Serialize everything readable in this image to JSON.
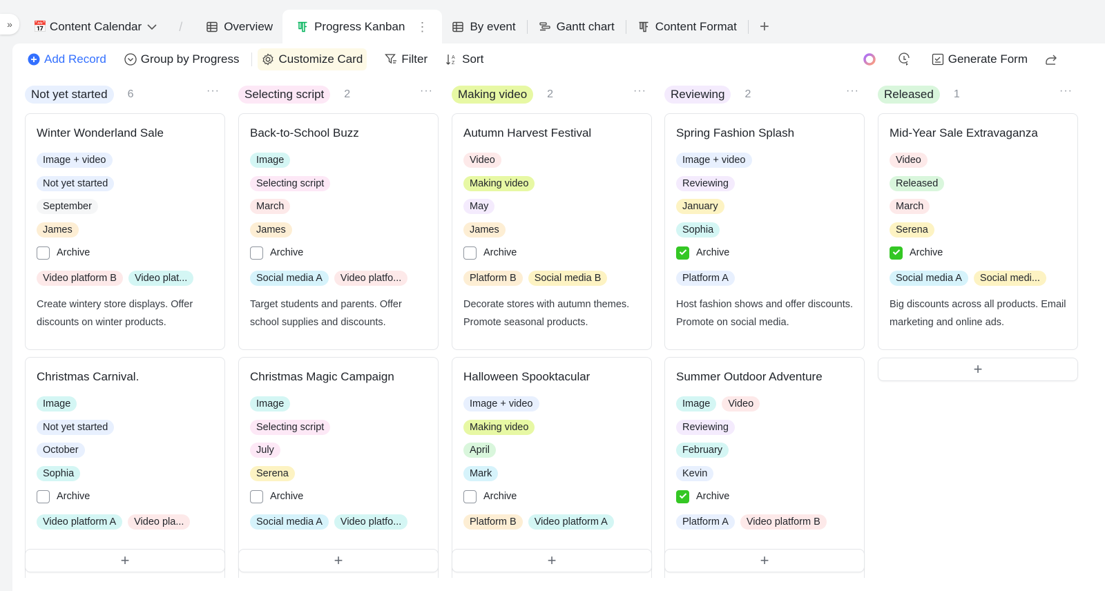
{
  "header": {
    "base_title": "Content Calendar",
    "tabs": [
      {
        "label": "Overview",
        "icon": "grid-table-icon"
      },
      {
        "label": "Progress Kanban",
        "icon": "kanban-icon",
        "active": true
      },
      {
        "label": "By event",
        "icon": "grid-table-icon"
      },
      {
        "label": "Gantt chart",
        "icon": "gantt-icon"
      },
      {
        "label": "Content Format",
        "icon": "kanban-icon"
      }
    ]
  },
  "toolbar": {
    "add_record": "Add Record",
    "group_by": "Group by Progress",
    "customize_card": "Customize Card",
    "filter": "Filter",
    "sort": "Sort",
    "generate_form": "Generate Form"
  },
  "columns": [
    {
      "name": "Not yet started",
      "count": "6",
      "color": "c-blue",
      "cards": [
        {
          "title": "Winter Wonderland Sale",
          "format": [
            {
              "t": "Image + video",
              "c": "c-blue"
            }
          ],
          "progress": {
            "t": "Not yet started",
            "c": "c-blue"
          },
          "month": {
            "t": "September",
            "c": "c-gray"
          },
          "owner": {
            "t": "James",
            "c": "c-orange"
          },
          "archive_label": "Archive",
          "archived": false,
          "channels": [
            {
              "t": "Video platform B",
              "c": "c-red"
            },
            {
              "t": "Video plat...",
              "c": "c-cyan"
            }
          ],
          "description": "Create wintery store displays. Offer discounts on winter products."
        },
        {
          "title": "Christmas Carnival.",
          "format": [
            {
              "t": "Image",
              "c": "c-cyan"
            }
          ],
          "progress": {
            "t": "Not yet started",
            "c": "c-blue"
          },
          "month": {
            "t": "October",
            "c": "c-blue"
          },
          "owner": {
            "t": "Sophia",
            "c": "c-cyan"
          },
          "archive_label": "Archive",
          "archived": false,
          "channels": [
            {
              "t": "Video platform A",
              "c": "c-cyan"
            },
            {
              "t": "Video pla...",
              "c": "c-red"
            }
          ],
          "description": ""
        }
      ]
    },
    {
      "name": "Selecting script",
      "count": "2",
      "color": "c-pink",
      "cards": [
        {
          "title": "Back-to-School Buzz",
          "format": [
            {
              "t": "Image",
              "c": "c-cyan"
            }
          ],
          "progress": {
            "t": "Selecting script",
            "c": "c-pink"
          },
          "month": {
            "t": "March",
            "c": "c-red"
          },
          "owner": {
            "t": "James",
            "c": "c-orange"
          },
          "archive_label": "Archive",
          "archived": false,
          "channels": [
            {
              "t": "Social media A",
              "c": "c-skyblue"
            },
            {
              "t": "Video platfo...",
              "c": "c-red"
            }
          ],
          "description": "Target students and parents. Offer school supplies and discounts."
        },
        {
          "title": "Christmas Magic Campaign",
          "format": [
            {
              "t": "Image",
              "c": "c-cyan"
            }
          ],
          "progress": {
            "t": "Selecting script",
            "c": "c-pink"
          },
          "month": {
            "t": "July",
            "c": "c-pink"
          },
          "owner": {
            "t": "Serena",
            "c": "c-yellow"
          },
          "archive_label": "Archive",
          "archived": false,
          "channels": [
            {
              "t": "Social media A",
              "c": "c-skyblue"
            },
            {
              "t": "Video platfo...",
              "c": "c-cyan"
            }
          ],
          "description": ""
        }
      ]
    },
    {
      "name": "Making video",
      "count": "2",
      "color": "c-lime",
      "cards": [
        {
          "title": "Autumn Harvest Festival",
          "format": [
            {
              "t": "Video",
              "c": "c-red"
            }
          ],
          "progress": {
            "t": "Making video",
            "c": "c-lime"
          },
          "month": {
            "t": "May",
            "c": "c-purple"
          },
          "owner": {
            "t": "James",
            "c": "c-orange"
          },
          "archive_label": "Archive",
          "archived": false,
          "channels": [
            {
              "t": "Platform B",
              "c": "c-orange"
            },
            {
              "t": "Social media B",
              "c": "c-yellow"
            }
          ],
          "description": "Decorate stores with autumn themes. Promote seasonal products."
        },
        {
          "title": "Halloween Spooktacular",
          "format": [
            {
              "t": "Image + video",
              "c": "c-blue"
            }
          ],
          "progress": {
            "t": "Making video",
            "c": "c-lime"
          },
          "month": {
            "t": "April",
            "c": "c-green"
          },
          "owner": {
            "t": "Mark",
            "c": "c-skyblue"
          },
          "archive_label": "Archive",
          "archived": false,
          "channels": [
            {
              "t": "Platform B",
              "c": "c-orange"
            },
            {
              "t": "Video platform A",
              "c": "c-cyan"
            }
          ],
          "description": ""
        }
      ]
    },
    {
      "name": "Reviewing",
      "count": "2",
      "color": "c-purple",
      "cards": [
        {
          "title": "Spring Fashion Splash",
          "format": [
            {
              "t": "Image + video",
              "c": "c-blue"
            }
          ],
          "progress": {
            "t": "Reviewing",
            "c": "c-purple"
          },
          "month": {
            "t": "January",
            "c": "c-yellow"
          },
          "owner": {
            "t": "Sophia",
            "c": "c-cyan"
          },
          "archive_label": "Archive",
          "archived": true,
          "channels": [
            {
              "t": "Platform A",
              "c": "c-blue"
            }
          ],
          "description": "Host fashion shows and offer discounts. Promote on social media."
        },
        {
          "title": "Summer Outdoor Adventure",
          "format": [
            {
              "t": "Image",
              "c": "c-cyan"
            },
            {
              "t": "Video",
              "c": "c-red"
            }
          ],
          "progress": {
            "t": "Reviewing",
            "c": "c-purple"
          },
          "month": {
            "t": "February",
            "c": "c-cyan"
          },
          "owner": {
            "t": "Kevin",
            "c": "c-blue"
          },
          "archive_label": "Archive",
          "archived": true,
          "channels": [
            {
              "t": "Platform A",
              "c": "c-blue"
            },
            {
              "t": "Video platform B",
              "c": "c-red"
            }
          ],
          "description": ""
        }
      ]
    },
    {
      "name": "Released",
      "count": "1",
      "color": "c-green",
      "cards": [
        {
          "title": "Mid-Year Sale Extravaganza",
          "format": [
            {
              "t": "Video",
              "c": "c-red"
            }
          ],
          "progress": {
            "t": "Released",
            "c": "c-green"
          },
          "month": {
            "t": "March",
            "c": "c-red"
          },
          "owner": {
            "t": "Serena",
            "c": "c-yellow"
          },
          "archive_label": "Archive",
          "archived": true,
          "channels": [
            {
              "t": "Social media A",
              "c": "c-skyblue"
            },
            {
              "t": "Social medi...",
              "c": "c-yellow"
            }
          ],
          "description": "Big discounts across all products. Email marketing and online ads."
        }
      ]
    }
  ],
  "add_card_symbol": "+"
}
